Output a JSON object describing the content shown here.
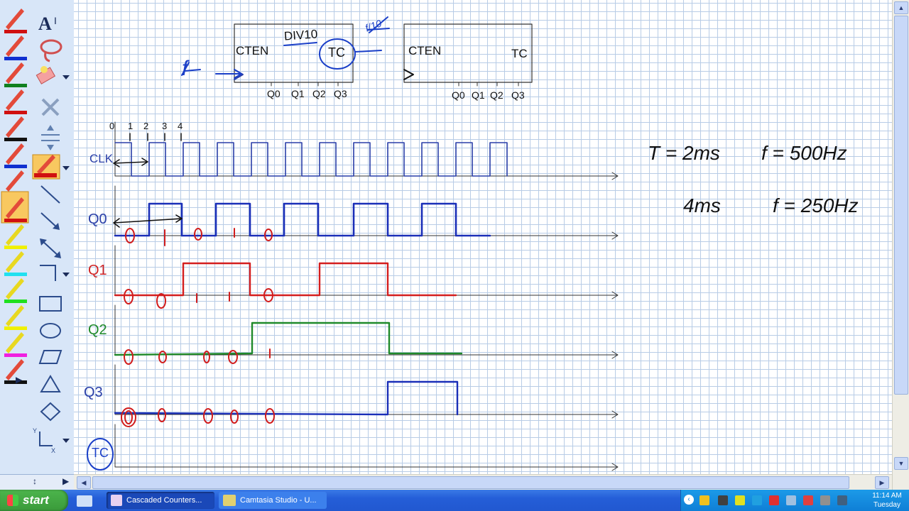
{
  "taskbar": {
    "start_label": "start",
    "tasks": [
      {
        "label": "Cascaded Counters..."
      },
      {
        "label": "Camtasia Studio - U..."
      }
    ],
    "clock": {
      "time": "11:14 AM",
      "day": "Tuesday"
    }
  },
  "whiteboard": {
    "counter1": {
      "ctrl_label": "CTEN",
      "name": "DIV10",
      "tc_label": "TC",
      "outputs": [
        "Q0",
        "Q1",
        "Q2",
        "Q3"
      ],
      "input_label": "f",
      "output_label": "f/10"
    },
    "counter2": {
      "ctrl_label": "CTEN",
      "tc_label": "TC",
      "outputs": [
        "Q0",
        "Q1",
        "Q2",
        "Q3"
      ]
    },
    "clock_counts": [
      "0",
      "1",
      "2",
      "3",
      "4"
    ],
    "signals": [
      {
        "label": "CLK",
        "color": "#2a3fa8"
      },
      {
        "label": "Q0",
        "color": "#2a3fa8"
      },
      {
        "label": "Q1",
        "color": "#d12424"
      },
      {
        "label": "Q2",
        "color": "#1f8a2a"
      },
      {
        "label": "Q3",
        "color": "#2a3fa8"
      },
      {
        "label": "TC",
        "color": "#2a3fa8"
      }
    ],
    "notes": {
      "period_clk": "T = 2ms",
      "freq_clk": "f = 500Hz",
      "period_q0": "4ms",
      "freq_q0": "f = 250Hz"
    }
  },
  "tools": [
    "red-pen",
    "blue-pen",
    "green-pen",
    "red-pen",
    "black-pen",
    "blue-pen",
    "green-pen",
    "red-pen",
    "yellow-highlighter",
    "cyan-highlighter",
    "green-highlighter",
    "yellow-highlighter",
    "magenta-highlighter",
    "black-pen"
  ]
}
